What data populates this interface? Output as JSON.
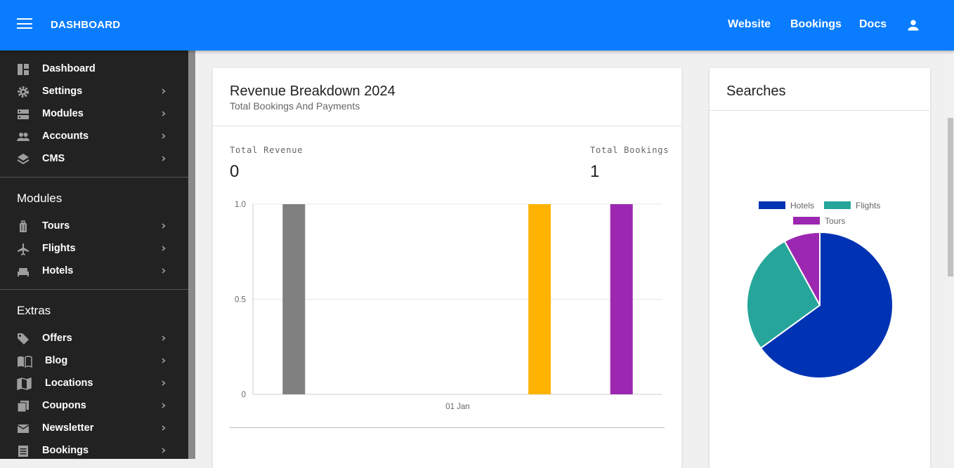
{
  "header": {
    "brand": "DASHBOARD",
    "links": [
      {
        "label": "Website"
      },
      {
        "label": "Bookings"
      },
      {
        "label": "Docs"
      }
    ]
  },
  "sidebar": {
    "main_items": [
      {
        "label": "Dashboard",
        "icon": "dashboard-icon",
        "has_submenu": false
      },
      {
        "label": "Settings",
        "icon": "gear-icon",
        "has_submenu": true
      },
      {
        "label": "Modules",
        "icon": "storage-icon",
        "has_submenu": true
      },
      {
        "label": "Accounts",
        "icon": "people-icon",
        "has_submenu": true
      },
      {
        "label": "CMS",
        "icon": "layers-icon",
        "has_submenu": true
      }
    ],
    "modules_heading": "Modules",
    "module_items": [
      {
        "label": "Tours",
        "icon": "luggage-icon",
        "has_submenu": true
      },
      {
        "label": "Flights",
        "icon": "airplane-icon",
        "has_submenu": true
      },
      {
        "label": "Hotels",
        "icon": "bed-icon",
        "has_submenu": true
      }
    ],
    "extras_heading": "Extras",
    "extra_items": [
      {
        "label": "Offers",
        "icon": "tag-icon",
        "has_submenu": true
      },
      {
        "label": "Blog",
        "icon": "book-icon",
        "has_submenu": true
      },
      {
        "label": "Locations",
        "icon": "map-icon",
        "has_submenu": true
      },
      {
        "label": "Coupons",
        "icon": "coupon-icon",
        "has_submenu": true
      },
      {
        "label": "Newsletter",
        "icon": "mail-icon",
        "has_submenu": true
      },
      {
        "label": "Bookings",
        "icon": "list-icon",
        "has_submenu": true
      }
    ]
  },
  "revenue_card": {
    "title": "Revenue Breakdown 2024",
    "subtitle": "Total Bookings And Payments",
    "total_revenue_label": "Total Revenue",
    "total_revenue_value": "0",
    "total_bookings_label": "Total Bookings",
    "total_bookings_value": "1"
  },
  "searches_card": {
    "title": "Searches"
  },
  "chart_data": [
    {
      "type": "bar",
      "categories": [
        "01 Jan"
      ],
      "series": [
        {
          "values": [
            1
          ],
          "color": "#808080"
        },
        {
          "values": [
            0
          ],
          "color": "#ffffff"
        },
        {
          "values": [
            0
          ],
          "color": "#ffffff"
        },
        {
          "values": [
            1
          ],
          "color": "#ffb300"
        },
        {
          "values": [
            1
          ],
          "color": "#9c27b0"
        }
      ],
      "yticks": [
        "0",
        "0.5",
        "1.0"
      ],
      "ylim": [
        0,
        1
      ],
      "grid": true
    },
    {
      "type": "pie",
      "labels": [
        "Hotels",
        "Flights",
        "Tours"
      ],
      "values": [
        65,
        27,
        8
      ],
      "colors": [
        "#0033b3",
        "#26a69a",
        "#9c27b0"
      ],
      "legend": "top"
    }
  ]
}
